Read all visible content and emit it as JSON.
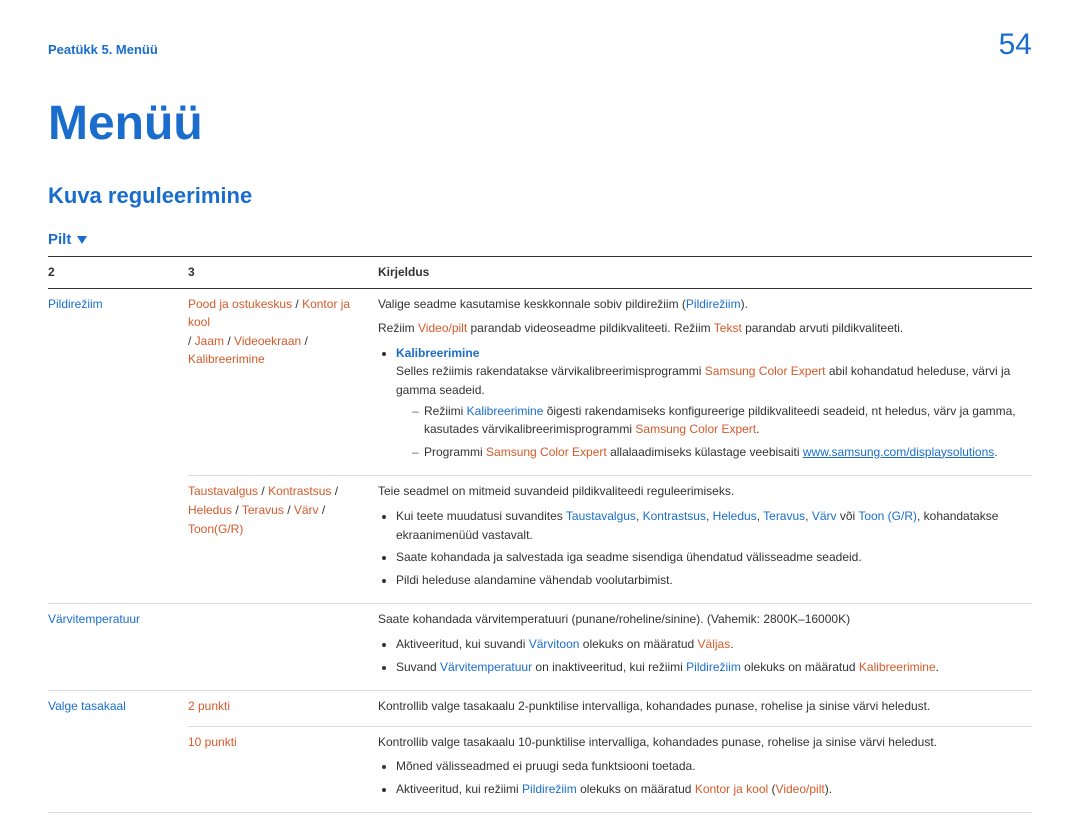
{
  "header": {
    "chapter": "Peatükk 5. Menüü",
    "page_number": "54"
  },
  "title": "Menüü",
  "section": "Kuva reguleerimine",
  "subsection": "Pilt",
  "table": {
    "headers": {
      "c2": "2",
      "c3": "3",
      "desc": "Kirjeldus"
    },
    "row1": {
      "c2": "Pildirežiim",
      "c3_parts": {
        "p1": "Pood ja ostukeskus",
        "sep1": " / ",
        "p2": "Kontor ja kool",
        "sep2": " / ",
        "p3": "Jaam",
        "sep3": " / ",
        "p4": "Videoekraan",
        "sep4": " / ",
        "p5": "Kalibreerimine"
      },
      "desc": {
        "line1_a": "Valige seadme kasutamise keskkonnale sobiv pildirežiim (",
        "line1_b": "Pildirežiim",
        "line1_c": ").",
        "line2_a": "Režiim ",
        "line2_b": "Video/pilt",
        "line2_c": " parandab videoseadme pildikvaliteeti. Režiim ",
        "line2_d": "Tekst",
        "line2_e": " parandab arvuti pildikvaliteeti.",
        "bul1": "Kalibreerimine",
        "bul1_text_a": "Selles režiimis rakendatakse värvikalibreerimisprogrammi ",
        "bul1_text_b": "Samsung Color Expert",
        "bul1_text_c": " abil kohandatud heleduse, värvi ja gamma seadeid.",
        "dash1_a": "Režiimi ",
        "dash1_b": "Kalibreerimine",
        "dash1_c": " õigesti rakendamiseks konfigureerige pildikvaliteedi seadeid, nt heledus, värv ja gamma, kasutades värvikalibreerimisprogrammi ",
        "dash1_d": "Samsung Color Expert",
        "dash1_e": ".",
        "dash2_a": "Programmi ",
        "dash2_b": "Samsung Color Expert",
        "dash2_c": " allalaadimiseks külastage veebisaiti ",
        "dash2_link": "www.samsung.com/displaysolutions",
        "dash2_d": "."
      }
    },
    "row2": {
      "c3_parts": {
        "p1": "Taustavalgus",
        "s1": " / ",
        "p2": "Kontrastsus",
        "s2": " / ",
        "p3": "Heledus",
        "s3": " / ",
        "p4": "Teravus",
        "s4": " / ",
        "p5": "Värv",
        "s5": " / ",
        "p6": "Toon(G/R)"
      },
      "desc": {
        "line1": "Teie seadmel on mitmeid suvandeid pildikvaliteedi reguleerimiseks.",
        "b1_a": "Kui teete muudatusi suvandites ",
        "b1_tv": "Taustavalgus",
        "b1_s1": ", ",
        "b1_ko": "Kontrastsus",
        "b1_s2": ", ",
        "b1_he": "Heledus",
        "b1_s3": ", ",
        "b1_te": "Teravus",
        "b1_s4": ", ",
        "b1_va": "Värv",
        "b1_s5": " või ",
        "b1_to": "Toon (G/R)",
        "b1_end": ", kohandatakse ekraanimenüüd vastavalt.",
        "b2": "Saate kohandada ja salvestada iga seadme sisendiga ühendatud välisseadme seadeid.",
        "b3": "Pildi heleduse alandamine vähendab voolutarbimist."
      }
    },
    "row3": {
      "c2": "Värvitemperatuur",
      "desc": {
        "line1": "Saate kohandada värvitemperatuuri (punane/roheline/sinine). (Vahemik: 2800K–16000K)",
        "b1_a": "Aktiveeritud, kui suvandi ",
        "b1_b": "Värvitoon",
        "b1_c": " olekuks on määratud ",
        "b1_d": "Väljas",
        "b1_e": ".",
        "b2_a": "Suvand ",
        "b2_b": "Värvitemperatuur",
        "b2_c": " on inaktiveeritud, kui režiimi ",
        "b2_d": "Pildirežiim",
        "b2_e": " olekuks on määratud ",
        "b2_f": "Kalibreerimine",
        "b2_g": "."
      }
    },
    "row4": {
      "c2": "Valge tasakaal",
      "c3a": "2 punkti",
      "desc_a": "Kontrollib valge tasakaalu 2-punktilise intervalliga, kohandades punase, rohelise ja sinise värvi heledust."
    },
    "row5": {
      "c3": "10 punkti",
      "desc": {
        "line1": "Kontrollib valge tasakaalu 10-punktilise intervalliga, kohandades punase, rohelise ja sinise värvi heledust.",
        "b1": "Mõned välisseadmed ei pruugi seda funktsiooni toetada.",
        "b2_a": "Aktiveeritud, kui režiimi ",
        "b2_b": "Pildirežiim",
        "b2_c": " olekuks on määratud ",
        "b2_d": "Kontor ja kool",
        "b2_e": " (",
        "b2_f": "Video/pilt",
        "b2_g": ")."
      }
    }
  }
}
